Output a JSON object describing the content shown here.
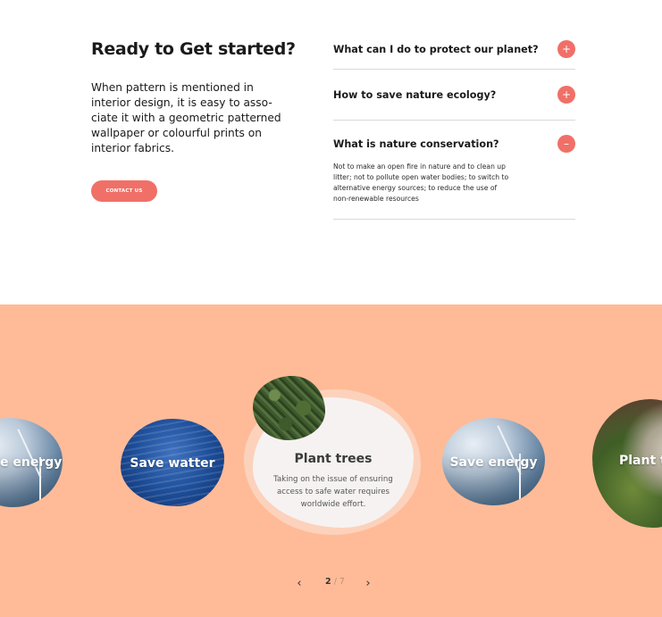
{
  "intro": {
    "title": "Ready to Get started?",
    "description_lines": [
      "When pattern is mentioned in",
      "interior design, it is easy to asso-",
      "ciate it with a geometric patterned",
      "wallpaper or colourful prints on",
      "interior fabrics."
    ],
    "contact_button": "CONTACT US"
  },
  "faq": [
    {
      "question": "What can I do to protect our planet?",
      "toggle": "+",
      "expanded": false
    },
    {
      "question": "How to save nature ecology?",
      "toggle": "+",
      "expanded": false
    },
    {
      "question": "What is nature conservation?",
      "toggle": "–",
      "expanded": true,
      "answer_lines": [
        "Not to make an open fire in nature and to clean up",
        "litter; not to pollute open water bodies; to switch to",
        "alternative energy sources; to reduce the use of",
        "non-renewable resources"
      ]
    }
  ],
  "carousel": {
    "slides": [
      {
        "label": "e energy",
        "image": "wind-turbines-photo"
      },
      {
        "label": "Save watter",
        "image": "ocean-water-photo"
      },
      {
        "label": "Plant trees",
        "image": "forest-photo",
        "active": true,
        "text_lines": [
          "Taking on the issue of ensuring",
          "access to safe water requires",
          "worldwide effort."
        ]
      },
      {
        "label": "Save energy",
        "image": "wind-turbines-photo"
      },
      {
        "label": "Plant t",
        "image": "watering-plants-photo"
      }
    ],
    "pager": {
      "current": "2",
      "separator": "/",
      "total": "7",
      "prev_icon": "chevron-left-icon",
      "next_icon": "chevron-right-icon"
    }
  },
  "colors": {
    "accent": "#f07068",
    "carousel_background": "#ffbb98",
    "card_background": "#f6f2f2"
  }
}
